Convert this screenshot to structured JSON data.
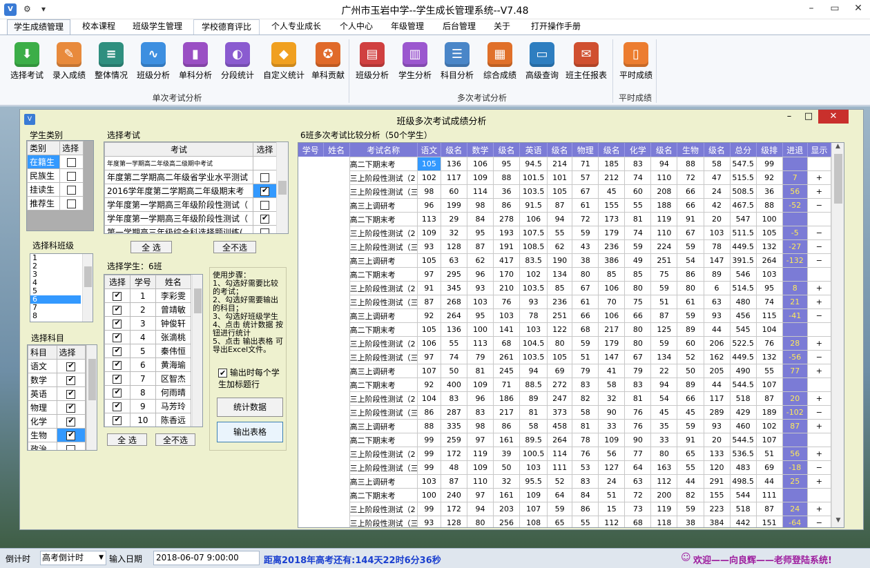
{
  "app": {
    "title": "广州市玉岩中学--学生成长管理系统--V7.48",
    "icon": "app-logo-icon",
    "quick": [
      "⚙",
      "▾"
    ]
  },
  "tabs": [
    "学生成绩管理",
    "校本课程",
    "班级学生管理",
    "学校德育评比",
    "个人专业成长",
    "个人中心",
    "年级管理",
    "后台管理",
    "关于",
    "打开操作手册"
  ],
  "ribbon": {
    "buttons": [
      {
        "label": "选择考试",
        "icon": "download-icon",
        "color": "#3cae48",
        "glyph": "⬇"
      },
      {
        "label": "录入成绩",
        "icon": "notepad-icon",
        "color": "#e88a3c",
        "glyph": "✎"
      },
      {
        "label": "整体情况",
        "icon": "layers-icon",
        "color": "#2f8f7f",
        "glyph": "≡"
      },
      {
        "label": "班级分析",
        "icon": "line-chart-icon",
        "color": "#3d8fe0",
        "glyph": "∿"
      },
      {
        "label": "单科分析",
        "icon": "bookmark-icon",
        "color": "#9a4fc4",
        "glyph": "▮"
      },
      {
        "label": "分段统计",
        "icon": "palette-icon",
        "color": "#8a5bd0",
        "glyph": "◐"
      },
      {
        "label": "自定义统计",
        "icon": "shield-icon",
        "color": "#f0a020",
        "glyph": "◆"
      },
      {
        "label": "单科贡献",
        "icon": "compass-icon",
        "color": "#e06a2a",
        "glyph": "✪"
      },
      {
        "label": "班级分析",
        "icon": "book-icon",
        "color": "#d04040",
        "glyph": "▤"
      },
      {
        "label": "学生分析",
        "icon": "bar-chart-icon",
        "color": "#9b57cf",
        "glyph": "▥"
      },
      {
        "label": "科目分析",
        "icon": "list-doc-icon",
        "color": "#4a86c8",
        "glyph": "☰"
      },
      {
        "label": "综合成绩",
        "icon": "report-icon",
        "color": "#e0702a",
        "glyph": "▦"
      },
      {
        "label": "高级查询",
        "icon": "card-icon",
        "color": "#2e7ec0",
        "glyph": "▭"
      },
      {
        "label": "班主任报表",
        "icon": "briefcase-icon",
        "color": "#d05030",
        "glyph": "✉"
      },
      {
        "label": "平时成绩",
        "icon": "document-icon",
        "color": "#ec7d30",
        "glyph": "▯"
      }
    ],
    "groups": [
      "单次考试分析",
      "多次考试分析",
      "平时成绩"
    ]
  },
  "window": {
    "title": "班级多次考试成绩分析",
    "icon": "window-logo-icon"
  },
  "student_type": {
    "label": "学生类别",
    "headers": [
      "类别",
      "选择"
    ],
    "items": [
      {
        "name": "在籍生",
        "checked": false
      },
      {
        "name": "民族生",
        "checked": false
      },
      {
        "name": "挂读生",
        "checked": false
      },
      {
        "name": "推荐生",
        "checked": false
      }
    ]
  },
  "select_exam": {
    "label": "选择考试",
    "headers": [
      "考试",
      "选择"
    ],
    "items": [
      {
        "name": "年度第一学期高二年级高二级期中考试",
        "checked": false
      },
      {
        "name": "年度第二学期高二年级省学业水平测试",
        "checked": false
      },
      {
        "name": "2016学年度第二学期高二年级期末考",
        "checked": true
      },
      {
        "name": "学年度第一学期高三年级阶段性测试（",
        "checked": false
      },
      {
        "name": "学年度第一学期高三年级阶段性测试（",
        "checked": true
      },
      {
        "name": "第一学期高三年级综合科选择题训练(",
        "checked": false
      }
    ],
    "select_all": "全 选",
    "select_none": "全不选"
  },
  "select_class": {
    "label": "选择科班级",
    "items": [
      "1",
      "2",
      "3",
      "4",
      "5",
      "6",
      "7",
      "8"
    ],
    "selected": "6"
  },
  "select_student": {
    "label": "选择学生：6班",
    "headers": [
      "选择",
      "学号",
      "姓名"
    ],
    "items": [
      {
        "no": "1",
        "name": "李彩雯"
      },
      {
        "no": "2",
        "name": "曾靖敏"
      },
      {
        "no": "3",
        "name": "钟俊轩"
      },
      {
        "no": "4",
        "name": "张滴桃"
      },
      {
        "no": "5",
        "name": "秦伟恒"
      },
      {
        "no": "6",
        "name": "黄海瑜"
      },
      {
        "no": "7",
        "name": "区智杰"
      },
      {
        "no": "8",
        "name": "何雨晴"
      },
      {
        "no": "9",
        "name": "马芳玲"
      },
      {
        "no": "10",
        "name": "陈香远"
      }
    ],
    "select_all": "全 选",
    "select_none": "全不选"
  },
  "select_subject": {
    "label": "选择科目",
    "headers": [
      "科目",
      "选择"
    ],
    "items": [
      {
        "name": "语文",
        "checked": true
      },
      {
        "name": "数学",
        "checked": true
      },
      {
        "name": "英语",
        "checked": true
      },
      {
        "name": "物理",
        "checked": true
      },
      {
        "name": "化学",
        "checked": true
      },
      {
        "name": "生物",
        "checked": true
      },
      {
        "name": "政治",
        "checked": false
      }
    ],
    "selected": "生物"
  },
  "steps": {
    "text": "使用步骤：\n1、勾选好需要比较的考试；\n2、勾选好需要输出的科目；\n3、勾选好班级学生\n4、点击 统计数据 按钮进行统计\n5、点击 输出表格 可导出Excel文件。",
    "check_label": "输出时每个学生加标题行",
    "check": true,
    "btn_stat": "统计数据",
    "btn_export": "输出表格"
  },
  "result": {
    "label": "6班多次考试比较分析（50个学生）",
    "headers": [
      "学号",
      "姓名",
      "考试名称",
      "语文",
      "级名",
      "数学",
      "级名",
      "英语",
      "级名",
      "物理",
      "级名",
      "化学",
      "级名",
      "生物",
      "级名",
      "总分",
      "级排",
      "进退",
      "显示"
    ],
    "rows": [
      [
        "",
        "",
        "高二下期末考",
        "105",
        "136",
        "106",
        "95",
        "94.5",
        "214",
        "71",
        "185",
        "83",
        "94",
        "88",
        "58",
        "547.5",
        "99",
        "",
        ""
      ],
      [
        "",
        "",
        "三上阶段性测试（2",
        "102",
        "117",
        "109",
        "88",
        "101.5",
        "101",
        "57",
        "212",
        "74",
        "110",
        "72",
        "47",
        "515.5",
        "92",
        "7",
        "+"
      ],
      [
        "",
        "",
        "三上阶段性测试（三",
        "98",
        "60",
        "114",
        "36",
        "103.5",
        "105",
        "67",
        "45",
        "60",
        "208",
        "66",
        "24",
        "508.5",
        "36",
        "56",
        "+"
      ],
      [
        "",
        "",
        "高三上调研考",
        "96",
        "199",
        "98",
        "86",
        "91.5",
        "87",
        "61",
        "155",
        "55",
        "188",
        "66",
        "42",
        "467.5",
        "88",
        "-52",
        "−"
      ],
      [
        "",
        "",
        "高二下期末考",
        "113",
        "29",
        "84",
        "278",
        "106",
        "94",
        "72",
        "173",
        "81",
        "119",
        "91",
        "20",
        "547",
        "100",
        "",
        ""
      ],
      [
        "",
        "",
        "三上阶段性测试（2",
        "109",
        "32",
        "95",
        "193",
        "107.5",
        "55",
        "59",
        "179",
        "74",
        "110",
        "67",
        "103",
        "511.5",
        "105",
        "-5",
        "−"
      ],
      [
        "",
        "",
        "三上阶段性测试（三",
        "93",
        "128",
        "87",
        "191",
        "108.5",
        "62",
        "43",
        "236",
        "59",
        "224",
        "59",
        "78",
        "449.5",
        "132",
        "-27",
        "−"
      ],
      [
        "",
        "",
        "高三上调研考",
        "105",
        "63",
        "62",
        "417",
        "83.5",
        "190",
        "38",
        "386",
        "49",
        "251",
        "54",
        "147",
        "391.5",
        "264",
        "-132",
        "−"
      ],
      [
        "",
        "",
        "高二下期末考",
        "97",
        "295",
        "96",
        "170",
        "102",
        "134",
        "80",
        "85",
        "85",
        "75",
        "86",
        "89",
        "546",
        "103",
        "",
        ""
      ],
      [
        "",
        "",
        "三上阶段性测试（2",
        "91",
        "345",
        "93",
        "210",
        "103.5",
        "85",
        "67",
        "106",
        "80",
        "59",
        "80",
        "6",
        "514.5",
        "95",
        "8",
        "+"
      ],
      [
        "",
        "",
        "三上阶段性测试（三",
        "87",
        "268",
        "103",
        "76",
        "93",
        "236",
        "61",
        "70",
        "75",
        "51",
        "61",
        "63",
        "480",
        "74",
        "21",
        "+"
      ],
      [
        "",
        "",
        "高三上调研考",
        "92",
        "264",
        "95",
        "103",
        "78",
        "251",
        "66",
        "106",
        "66",
        "87",
        "59",
        "93",
        "456",
        "115",
        "-41",
        "−"
      ],
      [
        "",
        "",
        "高二下期末考",
        "105",
        "136",
        "100",
        "141",
        "103",
        "122",
        "68",
        "217",
        "80",
        "125",
        "89",
        "44",
        "545",
        "104",
        "",
        ""
      ],
      [
        "",
        "",
        "三上阶段性测试（2",
        "106",
        "55",
        "113",
        "68",
        "104.5",
        "80",
        "59",
        "179",
        "80",
        "59",
        "60",
        "206",
        "522.5",
        "76",
        "28",
        "+"
      ],
      [
        "",
        "",
        "三上阶段性测试（三",
        "97",
        "74",
        "79",
        "261",
        "103.5",
        "105",
        "51",
        "147",
        "67",
        "134",
        "52",
        "162",
        "449.5",
        "132",
        "-56",
        "−"
      ],
      [
        "",
        "",
        "高三上调研考",
        "107",
        "50",
        "81",
        "245",
        "94",
        "69",
        "79",
        "41",
        "79",
        "22",
        "50",
        "205",
        "490",
        "55",
        "77",
        "+"
      ],
      [
        "",
        "",
        "高二下期末考",
        "92",
        "400",
        "109",
        "71",
        "88.5",
        "272",
        "83",
        "58",
        "83",
        "94",
        "89",
        "44",
        "544.5",
        "107",
        "",
        ""
      ],
      [
        "",
        "",
        "三上阶段性测试（2",
        "104",
        "83",
        "96",
        "186",
        "89",
        "247",
        "82",
        "32",
        "81",
        "54",
        "66",
        "117",
        "518",
        "87",
        "20",
        "+"
      ],
      [
        "",
        "",
        "三上阶段性测试（三",
        "86",
        "287",
        "83",
        "217",
        "81",
        "373",
        "58",
        "90",
        "76",
        "45",
        "45",
        "289",
        "429",
        "189",
        "-102",
        "−"
      ],
      [
        "",
        "",
        "高三上调研考",
        "88",
        "335",
        "98",
        "86",
        "58",
        "458",
        "81",
        "33",
        "76",
        "35",
        "59",
        "93",
        "460",
        "102",
        "87",
        "+"
      ],
      [
        "",
        "",
        "高二下期末考",
        "99",
        "259",
        "97",
        "161",
        "89.5",
        "264",
        "78",
        "109",
        "90",
        "33",
        "91",
        "20",
        "544.5",
        "107",
        "",
        ""
      ],
      [
        "",
        "",
        "三上阶段性测试（2",
        "99",
        "172",
        "119",
        "39",
        "100.5",
        "114",
        "76",
        "56",
        "77",
        "80",
        "65",
        "133",
        "536.5",
        "51",
        "56",
        "+"
      ],
      [
        "",
        "",
        "三上阶段性测试（三",
        "99",
        "48",
        "109",
        "50",
        "103",
        "111",
        "53",
        "127",
        "64",
        "163",
        "55",
        "120",
        "483",
        "69",
        "-18",
        "−"
      ],
      [
        "",
        "",
        "高三上调研考",
        "103",
        "87",
        "110",
        "32",
        "95.5",
        "52",
        "83",
        "24",
        "63",
        "112",
        "44",
        "291",
        "498.5",
        "44",
        "25",
        "+"
      ],
      [
        "",
        "",
        "高二下期末考",
        "100",
        "240",
        "97",
        "161",
        "109",
        "64",
        "84",
        "51",
        "72",
        "200",
        "82",
        "155",
        "544",
        "111",
        "",
        ""
      ],
      [
        "",
        "",
        "三上阶段性测试（2",
        "99",
        "172",
        "94",
        "203",
        "107",
        "59",
        "86",
        "15",
        "73",
        "119",
        "59",
        "223",
        "518",
        "87",
        "24",
        "+"
      ],
      [
        "",
        "",
        "三上阶段性测试（三",
        "93",
        "128",
        "80",
        "256",
        "108",
        "65",
        "55",
        "112",
        "68",
        "118",
        "38",
        "384",
        "442",
        "151",
        "-64",
        "−"
      ]
    ]
  },
  "status": {
    "countdown_label": "倒计时",
    "countdown_select": "高考倒计时",
    "input_date_label": "输入日期",
    "date_value": "2018-06-07  9:00:00",
    "distance_text": "距离2018年高考还有:144天22时6分36秒",
    "welcome": "欢迎——向良辉——老师登陆系统!",
    "user_icon": "user-icon"
  }
}
